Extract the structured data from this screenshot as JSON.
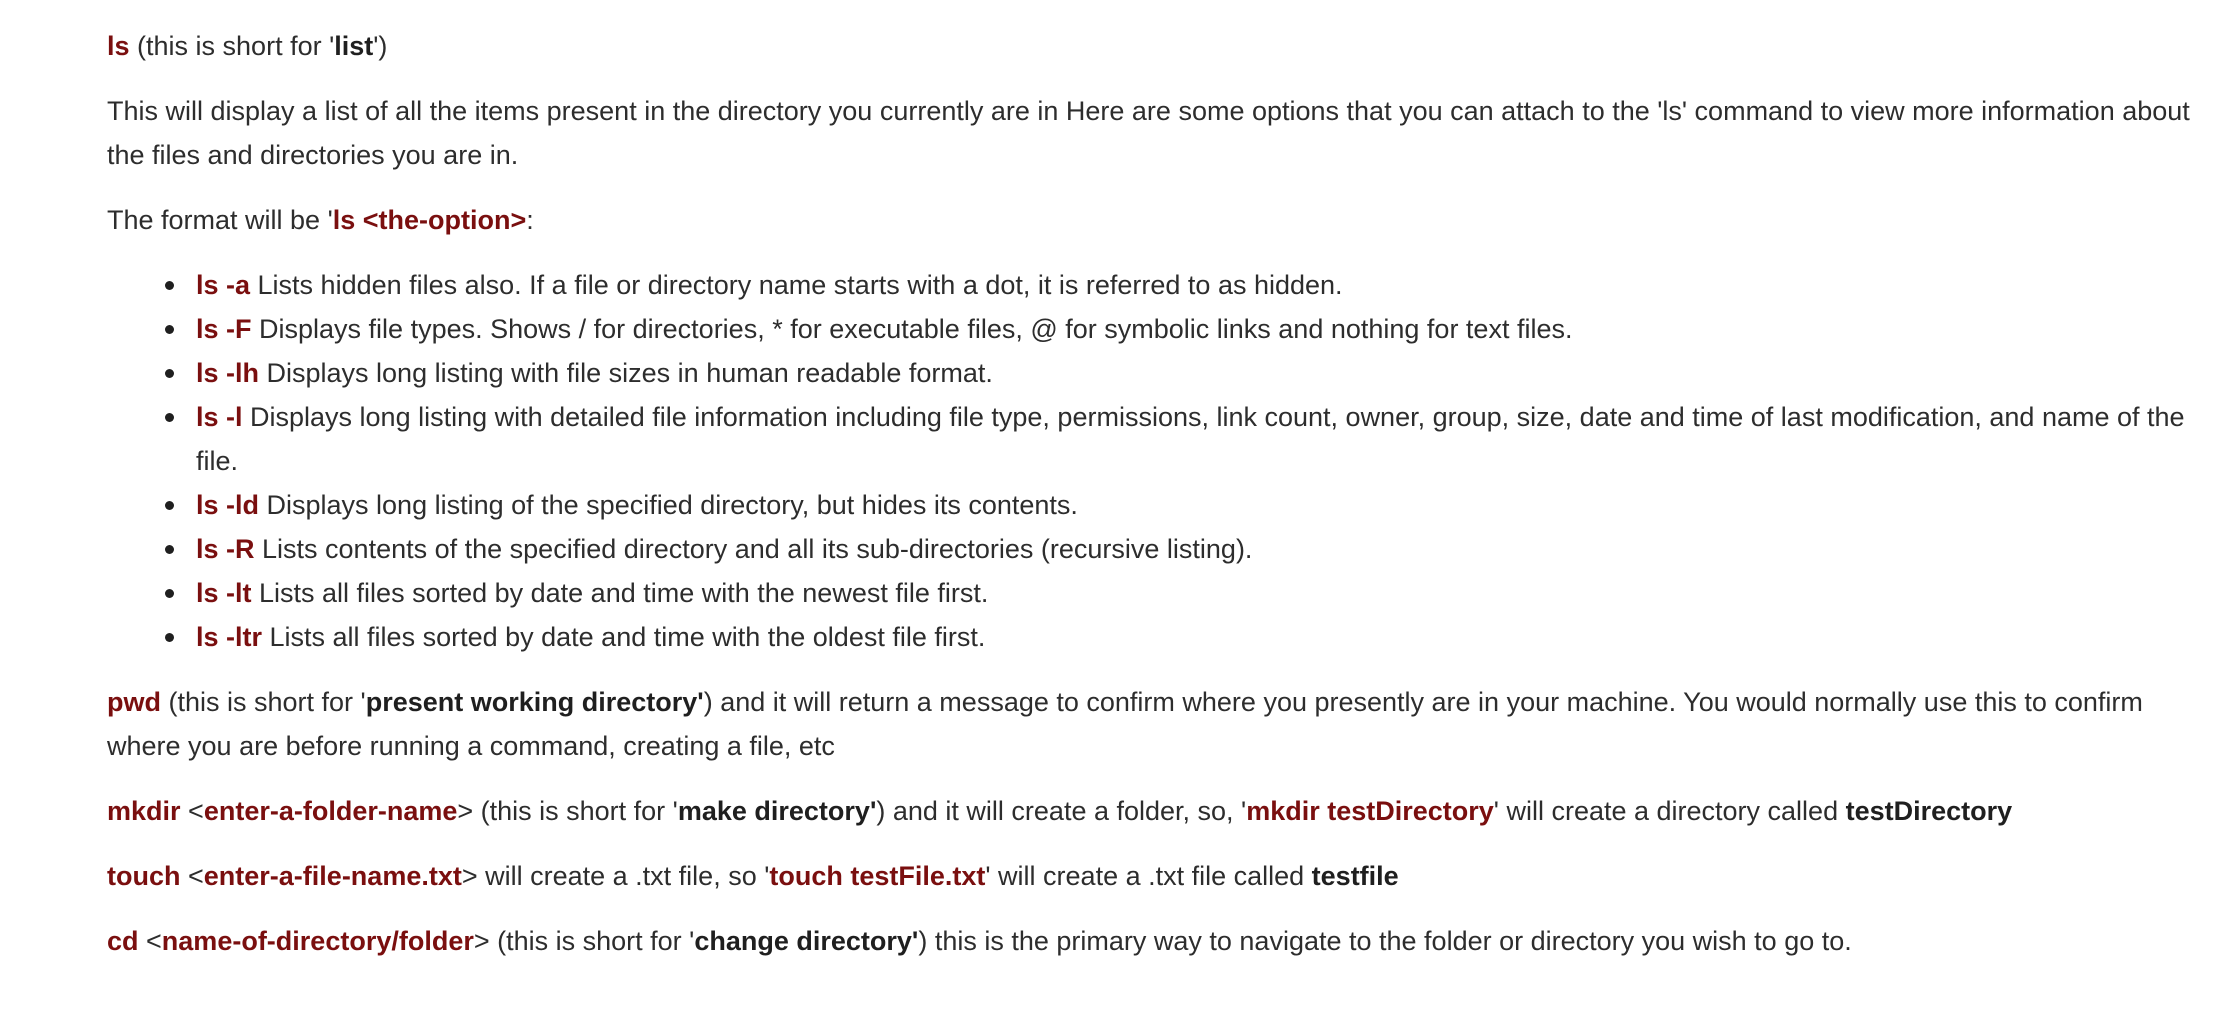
{
  "ls_intro": {
    "cmd": "ls",
    "paren_open": " (this is short for '",
    "term": "list",
    "paren_close": "')"
  },
  "ls_description": "This will display a list of all the items present in the directory you currently are in Here are some options that you can attach to the 'ls' command to view more information about the files and directories you are in.",
  "format_line": {
    "prefix": "The format will be '",
    "cmd": "ls <the-option>",
    "suffix": ":"
  },
  "options": [
    {
      "flag": "ls -a",
      "text": " Lists hidden files also. If a file or directory name starts with a dot, it is referred to as hidden."
    },
    {
      "flag": "ls -F",
      "text": " Displays file types. Shows / for directories, * for executable files, @ for symbolic links and nothing for text files."
    },
    {
      "flag": "ls -lh",
      "text": " Displays long listing with file sizes in human readable format."
    },
    {
      "flag": "ls -l",
      "text": " Displays long listing with detailed file information including file type, permissions, link count, owner, group, size, date and time of last modification, and name of the file."
    },
    {
      "flag": "ls -ld",
      "text": " Displays long listing of the specified directory, but hides its contents."
    },
    {
      "flag": "ls -R",
      "text": " Lists contents of the specified directory and all its sub-directories (recursive listing)."
    },
    {
      "flag": "ls -lt",
      "text": " Lists all files sorted by date and time with the newest file first."
    },
    {
      "flag": "ls -ltr",
      "text": " Lists all files sorted by date and time with the oldest file first."
    }
  ],
  "pwd": {
    "cmd": "pwd",
    "t1": " (this is short for '",
    "term": "present working directory'",
    "t2": ") and it will return a message to confirm where you presently are in your machine. You would normally use this to confirm where you are before running a command, creating a file, etc"
  },
  "mkdir": {
    "cmd": "mkdir",
    "t1": " <",
    "arg": "enter-a-folder-name",
    "t2": "> (this is short for '",
    "term": "make directory'",
    "t3": ") and it will create a folder, so, '",
    "example": "mkdir testDirectory",
    "t4": "' will create a directory called ",
    "result": "testDirectory"
  },
  "touch": {
    "cmd": "touch",
    "t1": " <",
    "arg": "enter-a-file-name.txt",
    "t2": "> will create a .txt file, so '",
    "example": "touch testFile.txt",
    "t3": "' will create a .txt file called ",
    "result": "testfile"
  },
  "cd": {
    "cmd": "cd",
    "t1": " <",
    "arg": "name-of-directory/folder",
    "t2": "> (this is short for '",
    "term": "change directory'",
    "t3": ") this is the primary way to navigate to the folder or directory you wish to go to."
  }
}
